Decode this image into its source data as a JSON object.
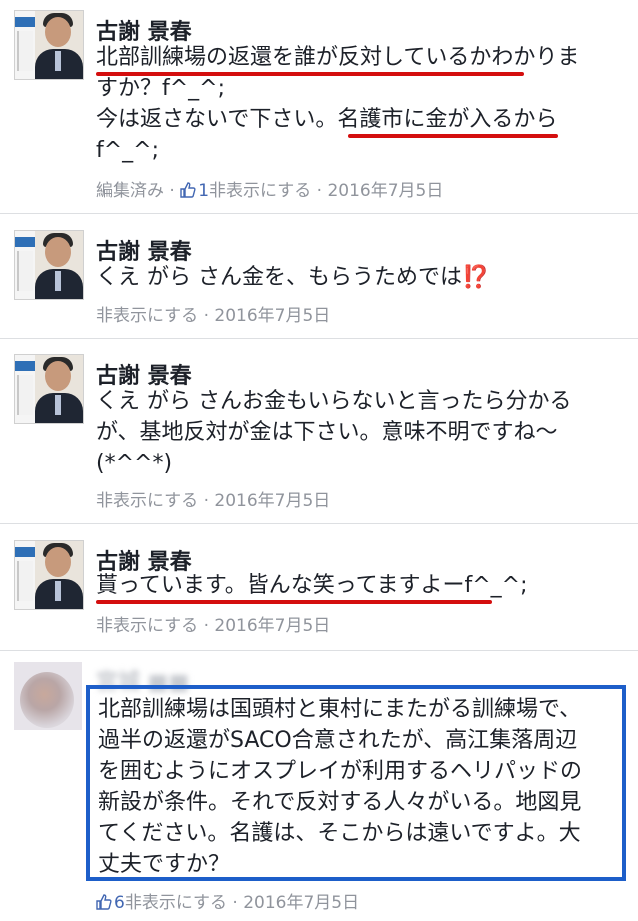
{
  "comments": [
    {
      "author": "古謝 景春",
      "lines": [
        "北部訓練場の返還を誰が反対しているかわかりま",
        "すか？f^_^;",
        "今は返さないで下さい。名護市に金が入るから",
        "f^_^;"
      ],
      "edited": "編集済み",
      "likes": "1",
      "hide": "非表示にする",
      "date": "2016年7月5日"
    },
    {
      "author": "古謝 景春",
      "lines": [
        "くえ がら さん金を、もらうためでは"
      ],
      "emoji": "⁉️",
      "hide": "非表示にする",
      "date": "2016年7月5日"
    },
    {
      "author": "古謝 景春",
      "lines": [
        "くえ がら さんお金もいらないと言ったら分かる",
        "が、基地反対が金は下さい。意味不明ですね〜",
        "(*^^*)"
      ],
      "hide": "非表示にする",
      "date": "2016年7月5日"
    },
    {
      "author": "古謝 景春",
      "lines": [
        "貰っています。皆んな笑ってますよーf^_^;"
      ],
      "hide": "非表示にする",
      "date": "2016年7月5日"
    },
    {
      "author": "宮城 ■■",
      "lines": [
        "北部訓練場は国頭村と東村にまたがる訓練場で、",
        "過半の返還がSACO合意されたが、高江集落周辺",
        "を囲むようにオスプレイが利用するヘリパッドの",
        "新設が条件。それで反対する人々がいる。地図見",
        "てください。名護は、そこからは遠いですよ。大",
        "丈夫ですか？"
      ],
      "likes": "6",
      "hide": "非表示にする",
      "date": "2016年7月5日"
    }
  ],
  "separator": " · ",
  "colors": {
    "link": "#4267b2",
    "meta": "#90949c",
    "underline": "#d40e0e",
    "highlight_box": "#1d5ec9"
  },
  "icons": {
    "like": "thumbs-up-icon"
  }
}
